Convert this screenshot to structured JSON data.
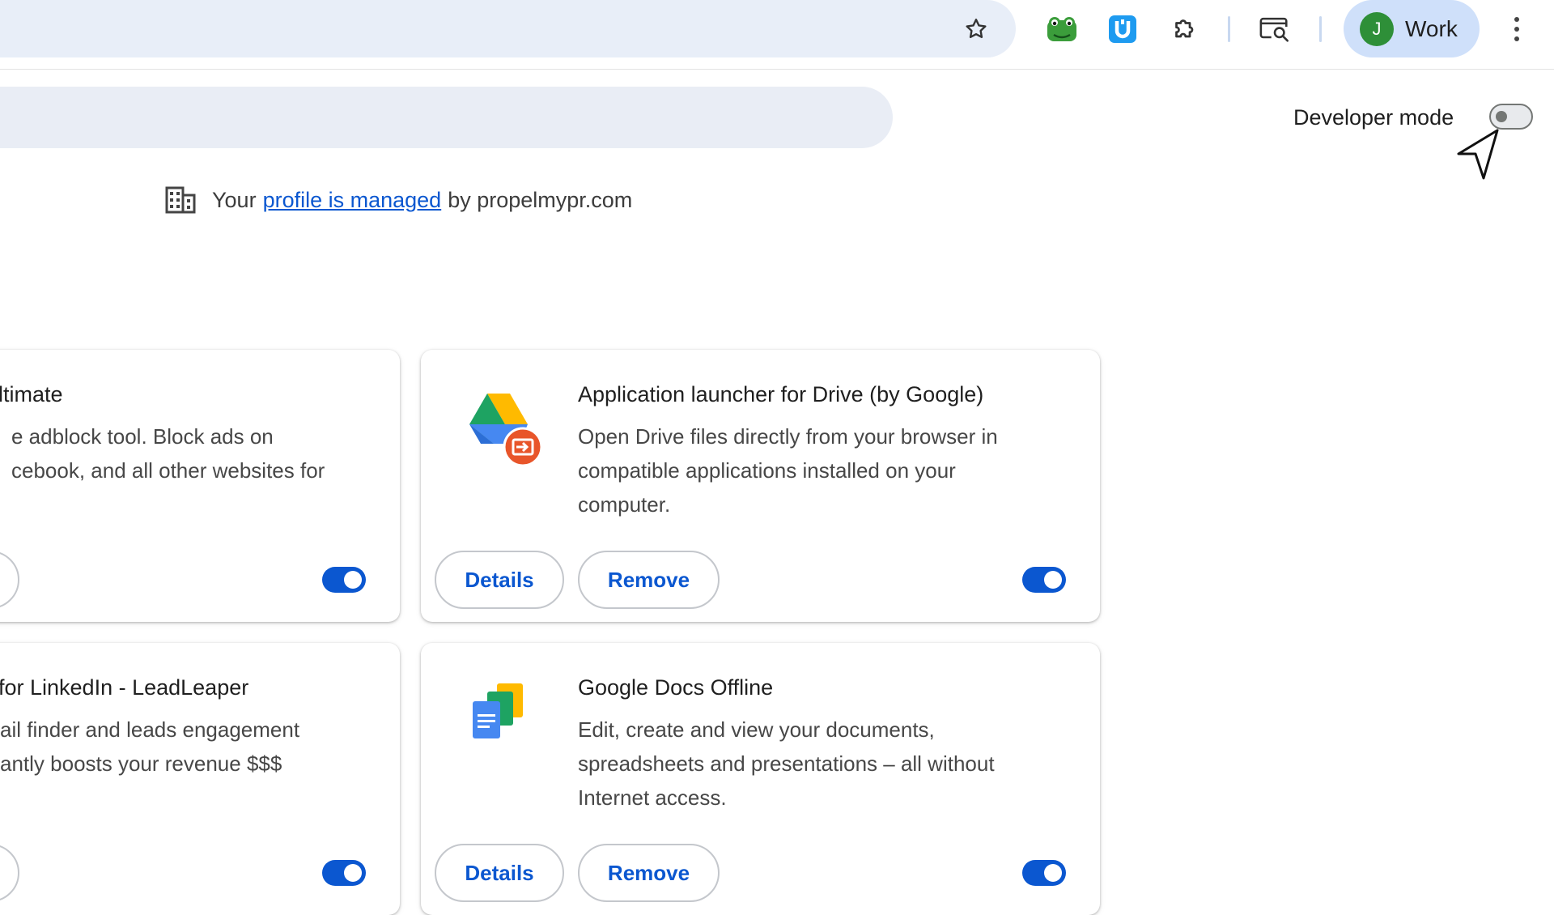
{
  "toolbar": {
    "profile_initial": "J",
    "profile_name": "Work",
    "icons": [
      "star-icon",
      "frog-extension-icon",
      "u-extension-icon",
      "puzzle-piece-icon",
      "tab-search-icon",
      "more-vert-icon"
    ]
  },
  "header": {
    "developer_mode_label": "Developer mode",
    "developer_mode_enabled": false
  },
  "managed": {
    "prefix": "Your",
    "link": "profile is managed",
    "suffix": "by propelmypr.com"
  },
  "cards": [
    {
      "title": "ltimate",
      "desc": [
        "e adblock tool. Block ads on",
        "cebook, and all other websites for"
      ],
      "enabled": true
    },
    {
      "title": "Application launcher for Drive (by Google)",
      "desc": [
        "Open Drive files directly from your browser in",
        "compatible applications installed on your",
        "computer."
      ],
      "details_label": "Details",
      "remove_label": "Remove",
      "enabled": true
    },
    {
      "title": "for LinkedIn - LeadLeaper",
      "desc": [
        "ail finder and leads engagement",
        "antly boosts your revenue $$$"
      ],
      "enabled": true
    },
    {
      "title": "Google Docs Offline",
      "desc": [
        "Edit, create and view your documents,",
        "spreadsheets and presentations – all without",
        "Internet access."
      ],
      "details_label": "Details",
      "remove_label": "Remove",
      "enabled": true
    }
  ],
  "colors": {
    "accent": "#0b57d0",
    "toolbar_chip": "#cfe0fa",
    "avatar": "#2e8f38"
  }
}
